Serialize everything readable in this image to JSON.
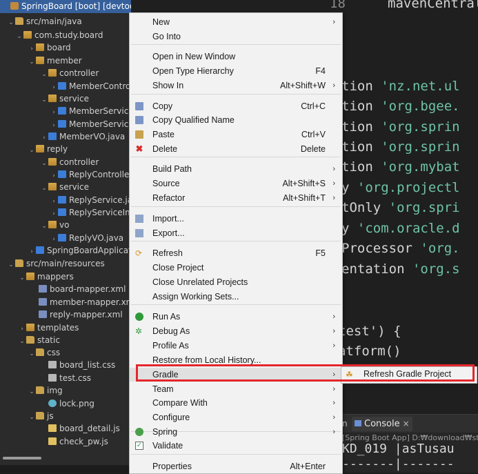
{
  "explorer": {
    "rows": [
      {
        "label": "SpringBoard [boot] [devtools]"
      },
      {
        "label": "src/main/java"
      },
      {
        "label": "com.study.board"
      },
      {
        "label": "board"
      },
      {
        "label": "member"
      },
      {
        "label": "controller"
      },
      {
        "label": "MemberContro"
      },
      {
        "label": "service"
      },
      {
        "label": "MemberService"
      },
      {
        "label": "MemberService"
      },
      {
        "label": "MemberVO.java"
      },
      {
        "label": "reply"
      },
      {
        "label": "controller"
      },
      {
        "label": "ReplyControlle"
      },
      {
        "label": "service"
      },
      {
        "label": "ReplyService.jav"
      },
      {
        "label": "ReplyServiceIm"
      },
      {
        "label": "vo"
      },
      {
        "label": "ReplyVO.java"
      },
      {
        "label": "SpringBoardApplicat"
      },
      {
        "label": "src/main/resources"
      },
      {
        "label": "mappers"
      },
      {
        "label": "board-mapper.xml"
      },
      {
        "label": "member-mapper.xml"
      },
      {
        "label": "reply-mapper.xml"
      },
      {
        "label": "templates"
      },
      {
        "label": "static"
      },
      {
        "label": "css"
      },
      {
        "label": "board_list.css"
      },
      {
        "label": "test.css"
      },
      {
        "label": "img"
      },
      {
        "label": "lock.png"
      },
      {
        "label": "js"
      },
      {
        "label": "board_detail.js"
      },
      {
        "label": "check_pw.js"
      }
    ]
  },
  "editor": {
    "line_number": "18",
    "top_code": "mavenCentral()",
    "lines": [
      {
        "a": "tion ",
        "b": "'nz.net.ul"
      },
      {
        "a": "tion ",
        "b": "'org.bgee."
      },
      {
        "a": "tion ",
        "b": "'org.sprin"
      },
      {
        "a": "tion ",
        "b": "'org.sprin"
      },
      {
        "a": "tion ",
        "b": "'org.mybat"
      },
      {
        "a": "y ",
        "b": "'org.projectl"
      },
      {
        "a": "tOnly ",
        "b": "'org.spri"
      },
      {
        "a": "y ",
        "b": "'com.oracle.d"
      },
      {
        "a": "Processor ",
        "b": "'org."
      },
      {
        "a": "entation ",
        "b": "'org.s"
      },
      {
        "a": "test') {",
        "b": ""
      },
      {
        "a": "atform()",
        "b": ""
      }
    ]
  },
  "menu": {
    "items": [
      {
        "label": "New",
        "shortcut": "",
        "arrow": "›",
        "icon": ""
      },
      {
        "label": "Go Into",
        "shortcut": "",
        "arrow": "",
        "icon": ""
      },
      {
        "label": "Open in New Window",
        "shortcut": "",
        "arrow": "",
        "icon": ""
      },
      {
        "label": "Open Type Hierarchy",
        "shortcut": "F4",
        "arrow": "",
        "icon": ""
      },
      {
        "label": "Show In",
        "shortcut": "Alt+Shift+W",
        "arrow": "›",
        "icon": ""
      },
      {
        "label": "Copy",
        "shortcut": "Ctrl+C",
        "arrow": "",
        "icon": "copy-icon"
      },
      {
        "label": "Copy Qualified Name",
        "shortcut": "",
        "arrow": "",
        "icon": "copy-qualified-icon"
      },
      {
        "label": "Paste",
        "shortcut": "Ctrl+V",
        "arrow": "",
        "icon": "paste-icon"
      },
      {
        "label": "Delete",
        "shortcut": "Delete",
        "arrow": "",
        "icon": "delete-icon"
      },
      {
        "label": "Build Path",
        "shortcut": "",
        "arrow": "›",
        "icon": ""
      },
      {
        "label": "Source",
        "shortcut": "Alt+Shift+S",
        "arrow": "›",
        "icon": ""
      },
      {
        "label": "Refactor",
        "shortcut": "Alt+Shift+T",
        "arrow": "›",
        "icon": ""
      },
      {
        "label": "Import...",
        "shortcut": "",
        "arrow": "",
        "icon": "import-icon"
      },
      {
        "label": "Export...",
        "shortcut": "",
        "arrow": "",
        "icon": "export-icon"
      },
      {
        "label": "Refresh",
        "shortcut": "F5",
        "arrow": "",
        "icon": "refresh-icon"
      },
      {
        "label": "Close Project",
        "shortcut": "",
        "arrow": "",
        "icon": ""
      },
      {
        "label": "Close Unrelated Projects",
        "shortcut": "",
        "arrow": "",
        "icon": ""
      },
      {
        "label": "Assign Working Sets...",
        "shortcut": "",
        "arrow": "",
        "icon": ""
      },
      {
        "label": "Run As",
        "shortcut": "",
        "arrow": "›",
        "icon": "run-icon"
      },
      {
        "label": "Debug As",
        "shortcut": "",
        "arrow": "›",
        "icon": "debug-icon"
      },
      {
        "label": "Profile As",
        "shortcut": "",
        "arrow": "›",
        "icon": ""
      },
      {
        "label": "Restore from Local History...",
        "shortcut": "",
        "arrow": "",
        "icon": ""
      },
      {
        "label": "Gradle",
        "shortcut": "",
        "arrow": "›",
        "icon": ""
      },
      {
        "label": "Team",
        "shortcut": "",
        "arrow": "›",
        "icon": ""
      },
      {
        "label": "Compare With",
        "shortcut": "",
        "arrow": "›",
        "icon": ""
      },
      {
        "label": "Configure",
        "shortcut": "",
        "arrow": "›",
        "icon": ""
      },
      {
        "label": "Spring",
        "shortcut": "",
        "arrow": "›",
        "icon": "spring-icon"
      },
      {
        "label": "Validate",
        "shortcut": "",
        "arrow": "",
        "icon": "validate-icon"
      },
      {
        "label": "Properties",
        "shortcut": "Alt+Enter",
        "arrow": "",
        "icon": ""
      }
    ]
  },
  "submenu": {
    "label": "Refresh Gradle Project",
    "icon": "gradle-icon"
  },
  "console": {
    "prev_tab": "n",
    "tab_label": "Console",
    "close": "×",
    "subtitle": "[Spring Boot App] D:₩download₩st",
    "line1": "KD_019 |asTusau",
    "line2": "-------|-------"
  },
  "colors": {
    "highlight": "#e4262c",
    "selection": "#36609c"
  }
}
